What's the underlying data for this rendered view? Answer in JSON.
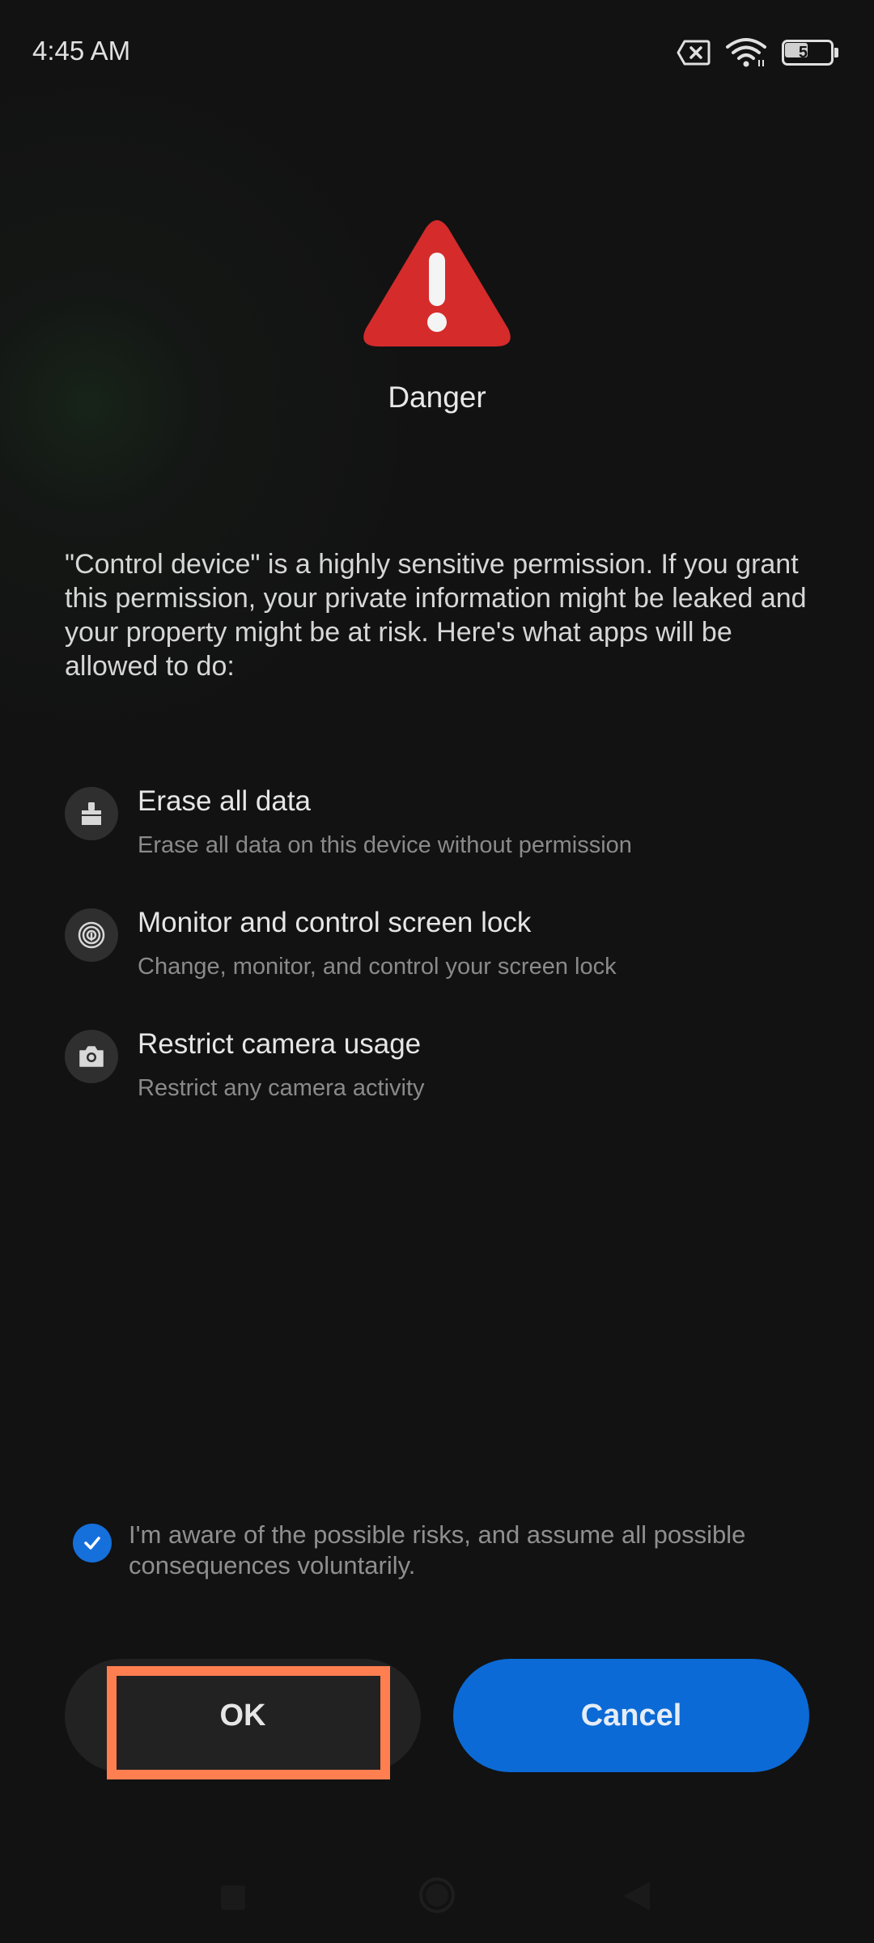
{
  "status_bar": {
    "time": "4:45 AM",
    "battery_level": "52",
    "icons": [
      "no-sim-icon",
      "wifi-icon",
      "battery-icon"
    ]
  },
  "header": {
    "icon": "warning-triangle-icon",
    "title": "Danger"
  },
  "description": "\"Control device\" is a highly sensitive permission. If you grant this permission, your private information might be leaked and your property might be at risk. Here's what apps will be allowed to do:",
  "permissions": [
    {
      "icon": "eraser-icon",
      "title": "Erase all data",
      "description": "Erase all data on this device without permission"
    },
    {
      "icon": "fingerprint-icon",
      "title": "Monitor and control screen lock",
      "description": "Change, monitor, and control your screen lock"
    },
    {
      "icon": "camera-icon",
      "title": "Restrict camera usage",
      "description": "Restrict any camera activity"
    }
  ],
  "consent": {
    "checked": true,
    "text": "I'm aware of the possible risks, and assume all possible consequences voluntarily."
  },
  "buttons": {
    "ok_label": "OK",
    "cancel_label": "Cancel"
  },
  "colors": {
    "background": "#121212",
    "danger_red": "#d52b2b",
    "accent_blue": "#0b6ad6",
    "highlight": "#ff7f50"
  },
  "nav_bar": {
    "icons": [
      "recent-apps-icon",
      "home-icon",
      "back-icon"
    ]
  }
}
